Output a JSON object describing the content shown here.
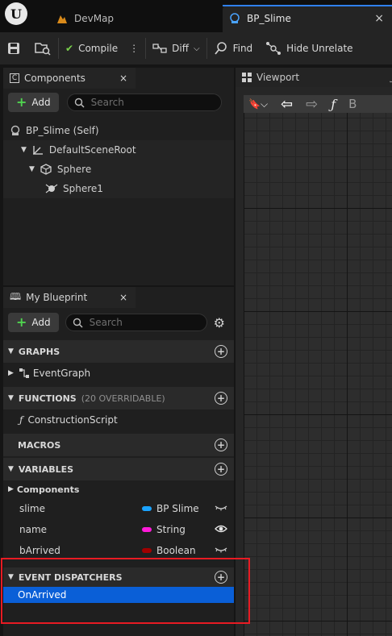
{
  "tabs": {
    "devmap": "DevMap",
    "bp_slime": "BP_Slime",
    "close": "×"
  },
  "toolbar": {
    "compile": "Compile",
    "diff": "Diff",
    "find": "Find",
    "hide_unrelated": "Hide Unrelate"
  },
  "components_panel": {
    "title": "Components",
    "close": "×",
    "add": "Add",
    "search_placeholder": "Search",
    "tree": {
      "self": "BP_Slime (Self)",
      "root": "DefaultSceneRoot",
      "sphere": "Sphere",
      "sphere1": "Sphere1"
    }
  },
  "viewport_tab": {
    "label": "Viewport"
  },
  "my_blueprint": {
    "title": "My Blueprint",
    "close": "×",
    "add": "Add",
    "search_placeholder": "Search",
    "sections": {
      "graphs": "GRAPHS",
      "event_graph": "EventGraph",
      "functions": "FUNCTIONS",
      "functions_note": "(20 OVERRIDABLE)",
      "construction_script": "ConstructionScript",
      "macros": "MACROS",
      "variables": "VARIABLES",
      "components": "Components",
      "event_dispatchers": "EVENT DISPATCHERS",
      "on_arrived": "OnArrived"
    },
    "variables": [
      {
        "name": "slime",
        "type": "BP Slime",
        "color": "#1aa3ff"
      },
      {
        "name": "name",
        "type": "String",
        "color": "#ff1ad9"
      },
      {
        "name": "bArrived",
        "type": "Boolean",
        "color": "#a00000"
      }
    ]
  },
  "colors": {
    "selection": "#0a5fd7",
    "highlight_box": "#e81b23",
    "tab_accent": "#2f80ed"
  }
}
